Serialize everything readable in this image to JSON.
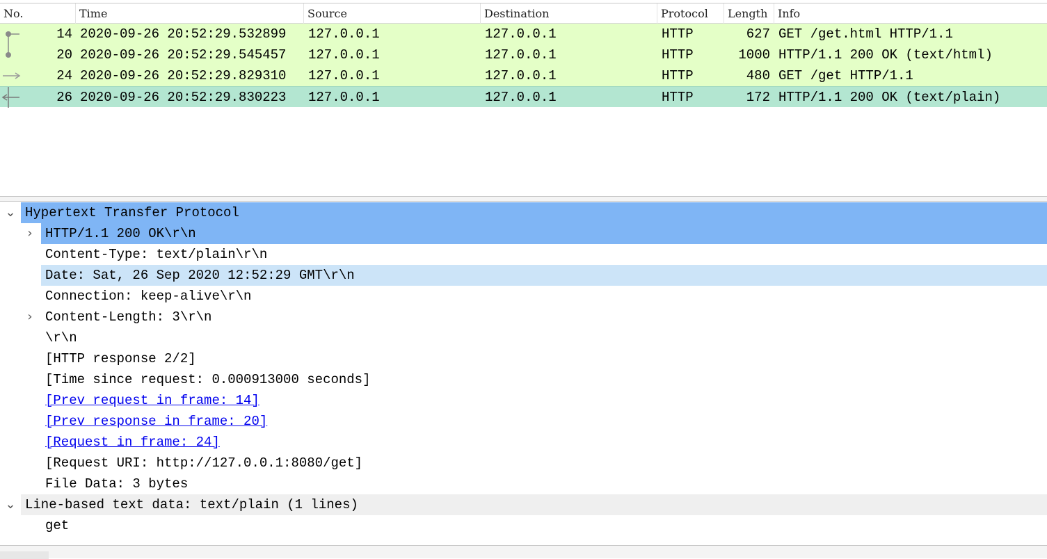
{
  "packet_list": {
    "columns": [
      "No.",
      "Time",
      "Source",
      "Destination",
      "Protocol",
      "Length",
      "Info"
    ],
    "rows": [
      {
        "no": "14",
        "time": "2020-09-26 20:52:29.532899",
        "source": "127.0.0.1",
        "destination": "127.0.0.1",
        "protocol": "HTTP",
        "length": "627",
        "info": "GET /get.html HTTP/1.1",
        "selected": false
      },
      {
        "no": "20",
        "time": "2020-09-26 20:52:29.545457",
        "source": "127.0.0.1",
        "destination": "127.0.0.1",
        "protocol": "HTTP",
        "length": "1000",
        "info": "HTTP/1.1 200 OK  (text/html)",
        "selected": false
      },
      {
        "no": "24",
        "time": "2020-09-26 20:52:29.829310",
        "source": "127.0.0.1",
        "destination": "127.0.0.1",
        "protocol": "HTTP",
        "length": "480",
        "info": "GET /get HTTP/1.1",
        "selected": false
      },
      {
        "no": "26",
        "time": "2020-09-26 20:52:29.830223",
        "source": "127.0.0.1",
        "destination": "127.0.0.1",
        "protocol": "HTTP",
        "length": "172",
        "info": "HTTP/1.1 200 OK  (text/plain)",
        "selected": true
      }
    ]
  },
  "details": {
    "http_header": "Hypertext Transfer Protocol",
    "status_line": "HTTP/1.1 200 OK\\r\\n",
    "content_type": "Content-Type: text/plain\\r\\n",
    "date": "Date: Sat, 26 Sep 2020 12:52:29 GMT\\r\\n",
    "connection": "Connection: keep-alive\\r\\n",
    "content_length": "Content-Length: 3\\r\\n",
    "crlf": "\\r\\n",
    "response_index": "[HTTP response 2/2]",
    "time_since": "[Time since request: 0.000913000 seconds]",
    "prev_request": "[Prev request in frame: 14]",
    "prev_response": "[Prev response in frame: 20]",
    "request_in": "[Request in frame: 24]",
    "request_uri": "[Request URI: http://127.0.0.1:8080/get]",
    "file_data": "File Data: 3 bytes",
    "line_based_header": "Line-based text data: text/plain (1 lines)",
    "line_text": "get"
  },
  "colors": {
    "http_row": "#e4ffc7",
    "selected_row": "#b3e6d1",
    "details_selected": "#7fb5f5",
    "details_hover": "#cce4f8",
    "section_gray": "#efefef",
    "link": "#0000ee"
  },
  "icons": {
    "expanded": "chevron-down-icon",
    "collapsed": "chevron-right-icon"
  }
}
